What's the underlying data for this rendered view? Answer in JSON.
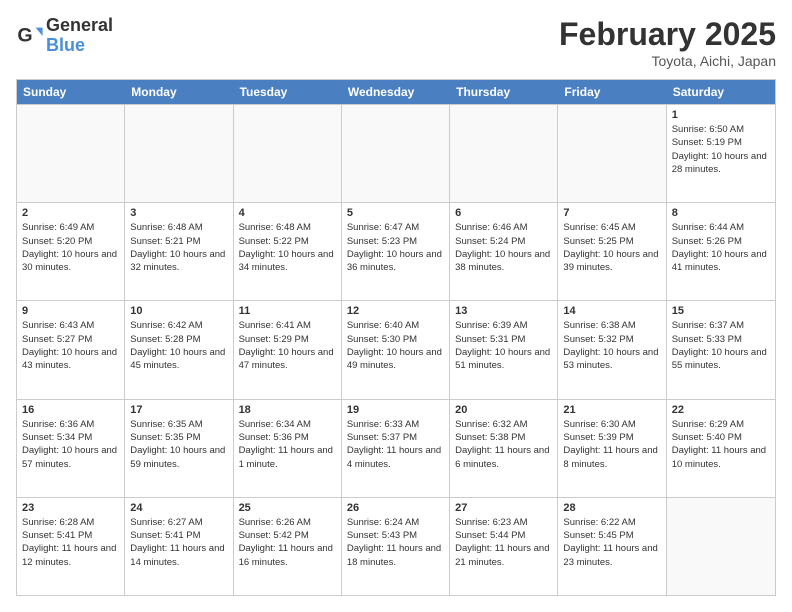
{
  "logo": {
    "text_general": "General",
    "text_blue": "Blue"
  },
  "header": {
    "month_year": "February 2025",
    "location": "Toyota, Aichi, Japan"
  },
  "days": [
    "Sunday",
    "Monday",
    "Tuesday",
    "Wednesday",
    "Thursday",
    "Friday",
    "Saturday"
  ],
  "rows": [
    [
      {
        "day": "",
        "text": "",
        "empty": true
      },
      {
        "day": "",
        "text": "",
        "empty": true
      },
      {
        "day": "",
        "text": "",
        "empty": true
      },
      {
        "day": "",
        "text": "",
        "empty": true
      },
      {
        "day": "",
        "text": "",
        "empty": true
      },
      {
        "day": "",
        "text": "",
        "empty": true
      },
      {
        "day": "1",
        "text": "Sunrise: 6:50 AM\nSunset: 5:19 PM\nDaylight: 10 hours and 28 minutes.",
        "empty": false
      }
    ],
    [
      {
        "day": "2",
        "text": "Sunrise: 6:49 AM\nSunset: 5:20 PM\nDaylight: 10 hours and 30 minutes.",
        "empty": false
      },
      {
        "day": "3",
        "text": "Sunrise: 6:48 AM\nSunset: 5:21 PM\nDaylight: 10 hours and 32 minutes.",
        "empty": false
      },
      {
        "day": "4",
        "text": "Sunrise: 6:48 AM\nSunset: 5:22 PM\nDaylight: 10 hours and 34 minutes.",
        "empty": false
      },
      {
        "day": "5",
        "text": "Sunrise: 6:47 AM\nSunset: 5:23 PM\nDaylight: 10 hours and 36 minutes.",
        "empty": false
      },
      {
        "day": "6",
        "text": "Sunrise: 6:46 AM\nSunset: 5:24 PM\nDaylight: 10 hours and 38 minutes.",
        "empty": false
      },
      {
        "day": "7",
        "text": "Sunrise: 6:45 AM\nSunset: 5:25 PM\nDaylight: 10 hours and 39 minutes.",
        "empty": false
      },
      {
        "day": "8",
        "text": "Sunrise: 6:44 AM\nSunset: 5:26 PM\nDaylight: 10 hours and 41 minutes.",
        "empty": false
      }
    ],
    [
      {
        "day": "9",
        "text": "Sunrise: 6:43 AM\nSunset: 5:27 PM\nDaylight: 10 hours and 43 minutes.",
        "empty": false
      },
      {
        "day": "10",
        "text": "Sunrise: 6:42 AM\nSunset: 5:28 PM\nDaylight: 10 hours and 45 minutes.",
        "empty": false
      },
      {
        "day": "11",
        "text": "Sunrise: 6:41 AM\nSunset: 5:29 PM\nDaylight: 10 hours and 47 minutes.",
        "empty": false
      },
      {
        "day": "12",
        "text": "Sunrise: 6:40 AM\nSunset: 5:30 PM\nDaylight: 10 hours and 49 minutes.",
        "empty": false
      },
      {
        "day": "13",
        "text": "Sunrise: 6:39 AM\nSunset: 5:31 PM\nDaylight: 10 hours and 51 minutes.",
        "empty": false
      },
      {
        "day": "14",
        "text": "Sunrise: 6:38 AM\nSunset: 5:32 PM\nDaylight: 10 hours and 53 minutes.",
        "empty": false
      },
      {
        "day": "15",
        "text": "Sunrise: 6:37 AM\nSunset: 5:33 PM\nDaylight: 10 hours and 55 minutes.",
        "empty": false
      }
    ],
    [
      {
        "day": "16",
        "text": "Sunrise: 6:36 AM\nSunset: 5:34 PM\nDaylight: 10 hours and 57 minutes.",
        "empty": false
      },
      {
        "day": "17",
        "text": "Sunrise: 6:35 AM\nSunset: 5:35 PM\nDaylight: 10 hours and 59 minutes.",
        "empty": false
      },
      {
        "day": "18",
        "text": "Sunrise: 6:34 AM\nSunset: 5:36 PM\nDaylight: 11 hours and 1 minute.",
        "empty": false
      },
      {
        "day": "19",
        "text": "Sunrise: 6:33 AM\nSunset: 5:37 PM\nDaylight: 11 hours and 4 minutes.",
        "empty": false
      },
      {
        "day": "20",
        "text": "Sunrise: 6:32 AM\nSunset: 5:38 PM\nDaylight: 11 hours and 6 minutes.",
        "empty": false
      },
      {
        "day": "21",
        "text": "Sunrise: 6:30 AM\nSunset: 5:39 PM\nDaylight: 11 hours and 8 minutes.",
        "empty": false
      },
      {
        "day": "22",
        "text": "Sunrise: 6:29 AM\nSunset: 5:40 PM\nDaylight: 11 hours and 10 minutes.",
        "empty": false
      }
    ],
    [
      {
        "day": "23",
        "text": "Sunrise: 6:28 AM\nSunset: 5:41 PM\nDaylight: 11 hours and 12 minutes.",
        "empty": false
      },
      {
        "day": "24",
        "text": "Sunrise: 6:27 AM\nSunset: 5:41 PM\nDaylight: 11 hours and 14 minutes.",
        "empty": false
      },
      {
        "day": "25",
        "text": "Sunrise: 6:26 AM\nSunset: 5:42 PM\nDaylight: 11 hours and 16 minutes.",
        "empty": false
      },
      {
        "day": "26",
        "text": "Sunrise: 6:24 AM\nSunset: 5:43 PM\nDaylight: 11 hours and 18 minutes.",
        "empty": false
      },
      {
        "day": "27",
        "text": "Sunrise: 6:23 AM\nSunset: 5:44 PM\nDaylight: 11 hours and 21 minutes.",
        "empty": false
      },
      {
        "day": "28",
        "text": "Sunrise: 6:22 AM\nSunset: 5:45 PM\nDaylight: 11 hours and 23 minutes.",
        "empty": false
      },
      {
        "day": "",
        "text": "",
        "empty": true
      }
    ]
  ]
}
